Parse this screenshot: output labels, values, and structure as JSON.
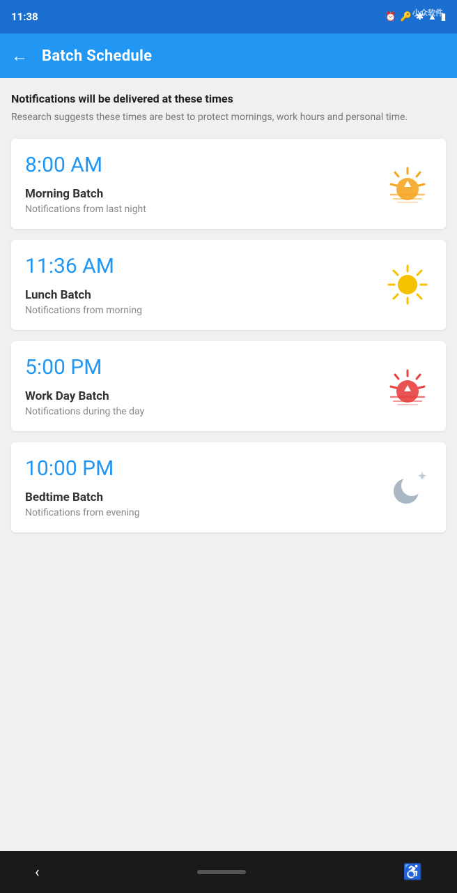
{
  "statusBar": {
    "time": "11:38",
    "watermark": "小众软件"
  },
  "appBar": {
    "backLabel": "←",
    "title": "Batch Schedule"
  },
  "description": {
    "title": "Notifications will be delivered at these times",
    "subtitle": "Research suggests these times are best to protect mornings, work hours and personal time."
  },
  "schedules": [
    {
      "time": "8:00 AM",
      "name": "Morning Batch",
      "desc": "Notifications from last night",
      "iconType": "sunrise"
    },
    {
      "time": "11:36 AM",
      "name": "Lunch Batch",
      "desc": "Notifications from morning",
      "iconType": "sun"
    },
    {
      "time": "5:00 PM",
      "name": "Work Day Batch",
      "desc": "Notifications during the day",
      "iconType": "sunset"
    },
    {
      "time": "10:00 PM",
      "name": "Bedtime Batch",
      "desc": "Notifications from evening",
      "iconType": "moon"
    }
  ],
  "bottomNav": {
    "backLabel": "‹",
    "accessibilityLabel": "♿"
  }
}
